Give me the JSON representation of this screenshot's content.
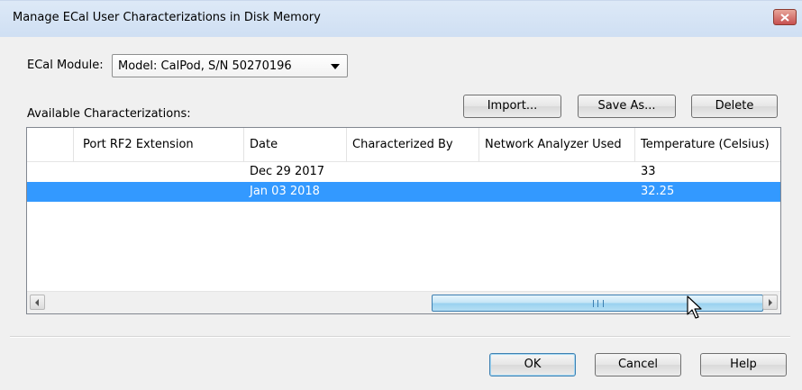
{
  "window": {
    "title": "Manage ECal User Characterizations in Disk Memory"
  },
  "module": {
    "label": "ECal Module:",
    "selected": "Model: CalPod, S/N 50270196"
  },
  "available_label": "Available Characterizations:",
  "buttons": {
    "import": "Import...",
    "save_as": "Save As...",
    "delete": "Delete",
    "ok": "OK",
    "cancel": "Cancel",
    "help": "Help"
  },
  "table": {
    "columns": [
      "",
      "Port RF2 Extension",
      "Date",
      "Characterized By",
      "Network Analyzer Used",
      "Temperature (Celsius)"
    ],
    "rows": [
      {
        "port_rf2": "",
        "date": "Dec 29 2017",
        "characterized_by": "",
        "analyzer": "",
        "temperature": "33",
        "selected": false
      },
      {
        "port_rf2": "",
        "date": "Jan 03 2018",
        "characterized_by": "",
        "analyzer": "",
        "temperature": "32.25",
        "selected": true
      }
    ]
  },
  "scrollbar": {
    "grip_text": "III"
  },
  "colors": {
    "selection": "#3399ff",
    "title_bar": "#dde9f7",
    "close_button": "#c75050"
  }
}
